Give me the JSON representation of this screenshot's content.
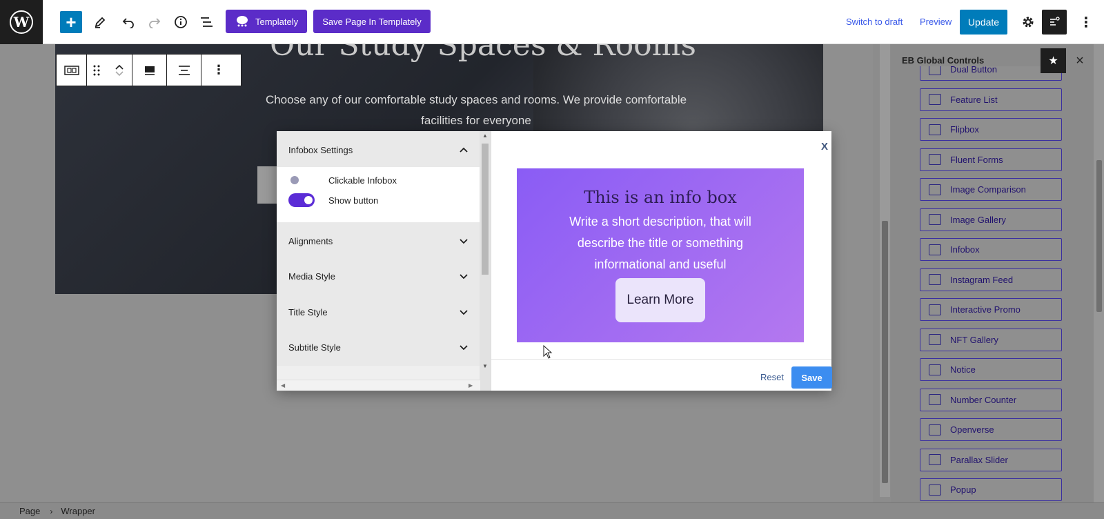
{
  "toolbar": {
    "templately_label": "Templately",
    "save_templately_label": "Save Page In Templately",
    "switch_draft_label": "Switch to draft",
    "preview_label": "Preview",
    "update_label": "Update"
  },
  "canvas": {
    "hero_title": "Our Study Spaces & Rooms",
    "hero_description": "Choose any of our comfortable study spaces and rooms. We provide comfortable facilities for everyone"
  },
  "modal": {
    "panels": [
      {
        "label": "Infobox Settings",
        "state": "expanded"
      },
      {
        "label": "Alignments",
        "state": "collapsed"
      },
      {
        "label": "Media Style",
        "state": "collapsed"
      },
      {
        "label": "Title Style",
        "state": "collapsed"
      },
      {
        "label": "Subtitle Style",
        "state": "collapsed"
      }
    ],
    "toggles": [
      {
        "label": "Clickable Infobox",
        "on": false
      },
      {
        "label": "Show button",
        "on": true
      }
    ],
    "close_label": "X",
    "preview": {
      "title": "This is an info box",
      "description": "Write a short description, that will describe the title or something informational and useful",
      "button_label": "Learn More"
    },
    "reset_label": "Reset",
    "save_label": "Save"
  },
  "sidebar": {
    "title": "EB Global Controls",
    "items": [
      {
        "label": "Dual Button",
        "icon": "dual-button-icon"
      },
      {
        "label": "Feature List",
        "icon": "feature-list-icon"
      },
      {
        "label": "Flipbox",
        "icon": "flipbox-icon"
      },
      {
        "label": "Fluent Forms",
        "icon": "fluent-forms-icon"
      },
      {
        "label": "Image Comparison",
        "icon": "image-comparison-icon"
      },
      {
        "label": "Image Gallery",
        "icon": "image-gallery-icon"
      },
      {
        "label": "Infobox",
        "icon": "infobox-icon"
      },
      {
        "label": "Instagram Feed",
        "icon": "instagram-feed-icon"
      },
      {
        "label": "Interactive Promo",
        "icon": "interactive-promo-icon"
      },
      {
        "label": "NFT Gallery",
        "icon": "nft-gallery-icon"
      },
      {
        "label": "Notice",
        "icon": "notice-icon"
      },
      {
        "label": "Number Counter",
        "icon": "number-counter-icon"
      },
      {
        "label": "Openverse",
        "icon": "openverse-icon"
      },
      {
        "label": "Parallax Slider",
        "icon": "parallax-slider-icon"
      },
      {
        "label": "Popup",
        "icon": "popup-icon"
      }
    ]
  },
  "breadcrumb": {
    "items": [
      "Page",
      "Wrapper"
    ]
  },
  "colors": {
    "wp_blue": "#007cba",
    "templately_purple": "#5b2cc8",
    "infobox_gradient_start": "#8a5cf5",
    "infobox_gradient_end": "#b478ef",
    "save_blue": "#3c8df0",
    "toggle_on": "#5b2cd6"
  }
}
